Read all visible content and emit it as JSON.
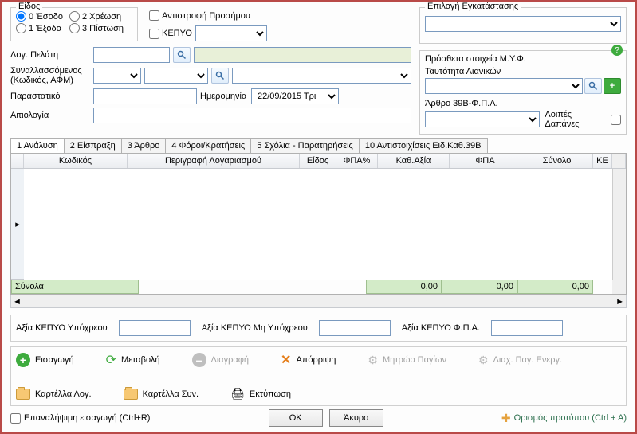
{
  "kind": {
    "legend": "Είδος",
    "r0": "0 Έσοδο",
    "r1": "1 Έξοδο",
    "r2": "2 Χρέωση",
    "r3": "3 Πίστωση"
  },
  "checks": {
    "sign_reverse": "Αντιστροφή Προσήμου",
    "kepyo": "ΚΕΠΥΟ"
  },
  "install": {
    "legend": "Επιλογή Εγκατάστασης"
  },
  "form": {
    "cust_acc": "Λογ. Πελάτη",
    "party": "Συναλλασσόμενος (Κωδικός, ΑΦΜ)",
    "voucher": "Παραστατικό",
    "date_label": "Ημερομηνία",
    "date_val": "22/09/2015 Τρι",
    "reason": "Αιτιολογία"
  },
  "myf": {
    "legend": "Πρόσθετα στοιχεία Μ.Υ.Φ.",
    "retail_id": "Ταυτότητα Λιανικών",
    "article39b": "Άρθρο 39Β-Φ.Π.Α.",
    "other_exp": "Λοιπές Δαπάνες"
  },
  "tabs": {
    "t1": "1 Ανάλυση",
    "t2": "2 Είσπραξη",
    "t3": "3 Άρθρο",
    "t4": "4 Φόροι/Κρατήσεις",
    "t5": "5 Σχόλια - Παρατηρήσεις",
    "t6": "10 Αντιστοιχίσεις Ειδ.Καθ.39Β"
  },
  "grid": {
    "code": "Κωδικός",
    "desc": "Περιγραφή Λογαριασμού",
    "kind": "Είδος",
    "vatpct": "ΦΠΑ%",
    "netval": "Καθ.Αξία",
    "vat": "ΦΠΑ",
    "total": "Σύνολο",
    "ke": "ΚΕ"
  },
  "totals": {
    "label": "Σύνολα",
    "v1": "0,00",
    "v2": "0,00",
    "v3": "0,00"
  },
  "kepyo_vals": {
    "l1": "Αξία ΚΕΠΥΟ Υπόχρεου",
    "l2": "Αξία ΚΕΠΥΟ Μη Υπόχρεου",
    "l3": "Αξία ΚΕΠΥΟ Φ.Π.Α."
  },
  "toolbar": {
    "insert": "Εισαγωγή",
    "modify": "Μεταβολή",
    "delete": "Διαγραφή",
    "reject": "Απόρριψη",
    "assets": "Μητρώο Παγίων",
    "pagenerg": "Διαχ. Παγ. Ενεργ.",
    "card_acc": "Καρτέλλα Λογ.",
    "card_party": "Καρτέλλα Συν.",
    "print": "Εκτύπωση"
  },
  "footer": {
    "repeat": "Επαναλήψιμη εισαγωγή (Ctrl+R)",
    "ok": "OK",
    "cancel": "Άκυρο",
    "template": "Ορισμός προτύπου (Ctrl + A)"
  }
}
